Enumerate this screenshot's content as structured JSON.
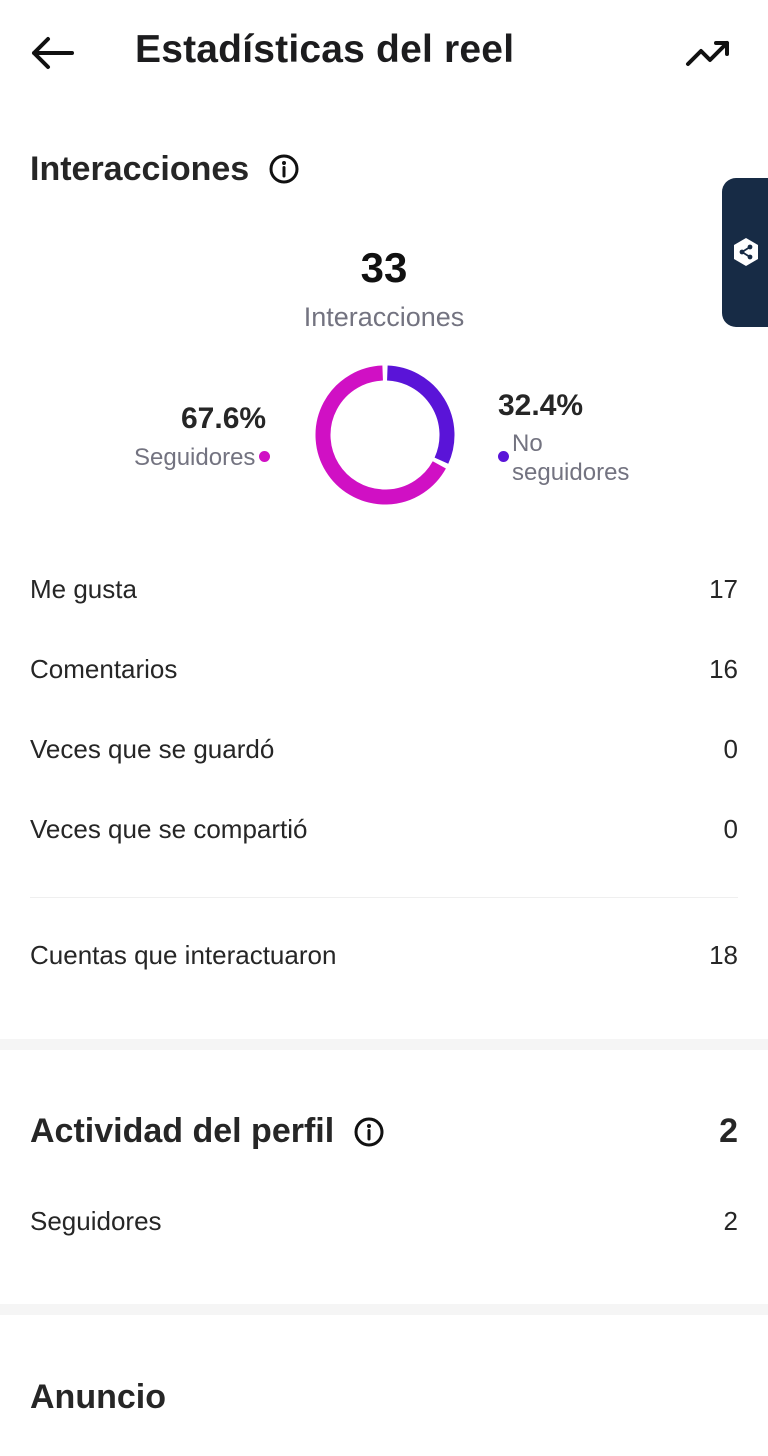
{
  "header": {
    "title": "Estadísticas del reel",
    "back_icon": "arrow-left-icon",
    "trend_icon": "trending-up-icon"
  },
  "interactions": {
    "title": "Interacciones",
    "info_icon": "info-icon",
    "total": "33",
    "total_label": "Interacciones",
    "followers_pct": "67.6%",
    "followers_label": "Seguidores",
    "non_followers_pct": "32.4%",
    "non_followers_label_line1": "No",
    "non_followers_label_line2": "seguidores",
    "followers_fraction": 0.676,
    "non_followers_fraction": 0.324,
    "colors": {
      "followers": "#d010c4",
      "non_followers": "#5a14d8"
    }
  },
  "stats": [
    {
      "label": "Me gusta",
      "value": "17"
    },
    {
      "label": "Comentarios",
      "value": "16"
    },
    {
      "label": "Veces que se guardó",
      "value": "0"
    },
    {
      "label": "Veces que se compartió",
      "value": "0"
    }
  ],
  "accounts": {
    "label": "Cuentas que interactuaron",
    "value": "18"
  },
  "profile_activity": {
    "title": "Actividad del perfil",
    "info_icon": "info-icon",
    "total": "2",
    "rows": [
      {
        "label": "Seguidores",
        "value": "2"
      }
    ]
  },
  "ad": {
    "title": "Anuncio"
  },
  "side_tab": {
    "icon": "share-bubble-icon",
    "color": "#172b45"
  }
}
